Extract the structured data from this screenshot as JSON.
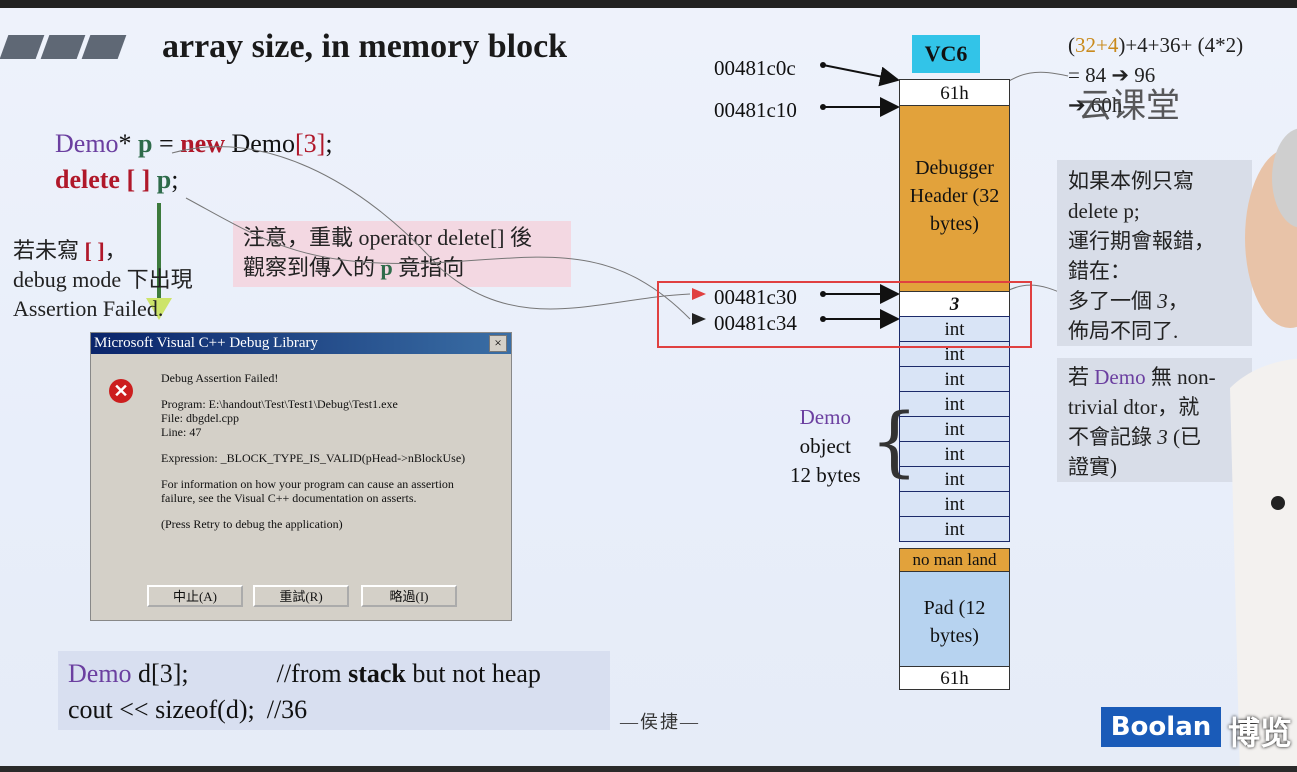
{
  "slide": {
    "title": "array size, in memory block",
    "code_top": {
      "l1_a": "Demo",
      "l1_b": "* ",
      "l1_c": "p",
      "l1_d": " = ",
      "l1_e": "new",
      "l1_f": " Demo",
      "l1_g": "[3]",
      "l1_h": ";",
      "l2_a": "delete [ ]",
      "l2_b": " p",
      "l2_c": ";"
    },
    "note_left": {
      "l1a": "若未寫 ",
      "l1b": "[ ]",
      "l1c": "，",
      "l2": "debug mode 下出現",
      "l3": "Assertion Failed."
    },
    "pink_note": {
      "l1": "注意，重載 operator delete[] 後",
      "l2a": "觀察到傳入的 ",
      "l2b": "p",
      "l2c": " 竟指向"
    },
    "dialog": {
      "title": "Microsoft Visual C++ Debug Library",
      "close": "×",
      "msg1": "Debug Assertion Failed!",
      "program": "Program: E:\\handout\\Test\\Test1\\Debug\\Test1.exe",
      "file": "File: dbgdel.cpp",
      "line": "Line: 47",
      "expression": "Expression: _BLOCK_TYPE_IS_VALID(pHead->nBlockUse)",
      "info1": "For information on how your program can cause an assertion",
      "info2": "failure, see the Visual C++ documentation on asserts.",
      "retry": "(Press Retry to debug the application)",
      "btn_abort": "中止(A)",
      "btn_retry": "重試(R)",
      "btn_ignore": "略過(I)"
    },
    "bottom_code": {
      "l1_a": "Demo",
      "l1_b": " d[3];",
      "l1_c": "//from ",
      "l1_d": "stack",
      "l1_e": " but not heap",
      "l2_a": "cout << sizeof(d);",
      "l2_b": "//36"
    },
    "author": "—侯捷—",
    "addresses": {
      "a1": "00481c0c",
      "a2": "00481c10",
      "a3": "00481c30",
      "a4": "00481c34"
    },
    "vc6": "VC6",
    "memory": {
      "top": "61h",
      "header": "Debugger Header (32 bytes)",
      "count": "3",
      "ints": [
        "int",
        "int",
        "int",
        "int",
        "int",
        "int",
        "int",
        "int",
        "int"
      ],
      "nomansland": "no man land",
      "pad": "Pad (12 bytes)",
      "bottom": "61h"
    },
    "demo_label": {
      "l1": "Demo",
      "l2": "object",
      "l3": "12 bytes"
    },
    "formula": {
      "l1a": "(",
      "l1b": "32+4",
      "l1c": ")+4+36+ (4*2)",
      "l2": "= 84 ➔ 96",
      "l3": "➔ 60h"
    },
    "right_note1": {
      "l1": "如果本例只寫",
      "l2": "delete p;",
      "l3": "運行期會報錯，",
      "l4": "錯在：",
      "l5a": "多了一個 ",
      "l5b": "3",
      "l5c": "，",
      "l6": "佈局不同了."
    },
    "right_note2": {
      "l1a": "若 ",
      "l1b": "Demo",
      "l1c": " 無 non-",
      "l2": "trivial dtor，就",
      "l3a": "不會記錄 ",
      "l3b": "3",
      "l3c": " (已",
      "l4": "證實)"
    },
    "watermark": "云课堂",
    "brand": "Boolan",
    "brand_cn": "博览"
  }
}
